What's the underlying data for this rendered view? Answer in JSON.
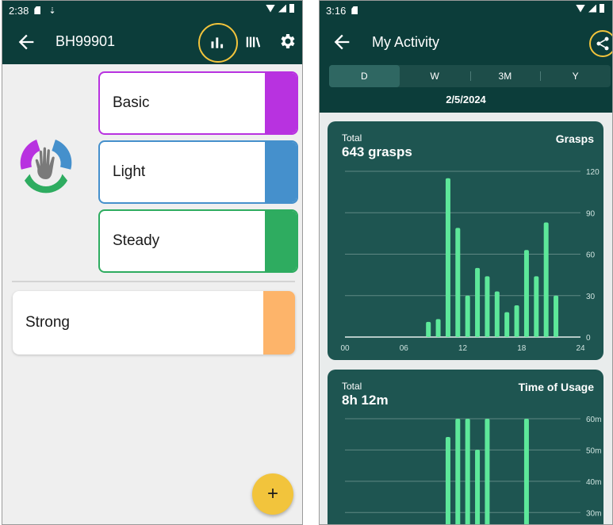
{
  "left": {
    "status": {
      "time": "2:38"
    },
    "appbar": {
      "title": "BH99901"
    },
    "cards": [
      {
        "label": "Basic",
        "color": "#b832e0"
      },
      {
        "label": "Light",
        "color": "#4590cc"
      },
      {
        "label": "Steady",
        "color": "#2eac60"
      }
    ],
    "strong": {
      "label": "Strong",
      "color": "#fdb46a"
    },
    "fab": {
      "label": "+"
    }
  },
  "right": {
    "status": {
      "time": "3:16"
    },
    "appbar": {
      "title": "My Activity"
    },
    "tabs": [
      "D",
      "W",
      "3M",
      "Y"
    ],
    "selected_tab": "D",
    "date": "2/5/2024",
    "grasps_panel": {
      "total_label": "Total",
      "total_value": "643 grasps",
      "title": "Grasps"
    },
    "usage_panel": {
      "total_label": "Total",
      "total_value": "8h 12m",
      "title": "Time of Usage"
    }
  },
  "chart_data": [
    {
      "type": "bar",
      "title": "Grasps",
      "x": [
        8,
        9,
        10,
        11,
        12,
        13,
        14,
        15,
        16,
        17,
        18,
        19,
        20,
        21
      ],
      "values": [
        11,
        13,
        115,
        79,
        30,
        50,
        44,
        33,
        18,
        23,
        63,
        44,
        83,
        30
      ],
      "xticks": [
        "00",
        "06",
        "12",
        "18",
        "24"
      ],
      "xlim": [
        0,
        24
      ],
      "yticks": [
        "0",
        "30",
        "60",
        "90",
        "120"
      ],
      "ylim": [
        0,
        120
      ],
      "grid": true,
      "color": "#5de89a"
    },
    {
      "type": "bar",
      "title": "Time of Usage",
      "x": [
        10,
        11,
        12,
        13,
        14,
        18
      ],
      "values": [
        50,
        60,
        60,
        43,
        60,
        60
      ],
      "yticks": [
        "30m",
        "40m",
        "50m",
        "60m"
      ],
      "ylim": [
        0,
        60
      ],
      "grid": true,
      "color": "#5de89a"
    }
  ]
}
